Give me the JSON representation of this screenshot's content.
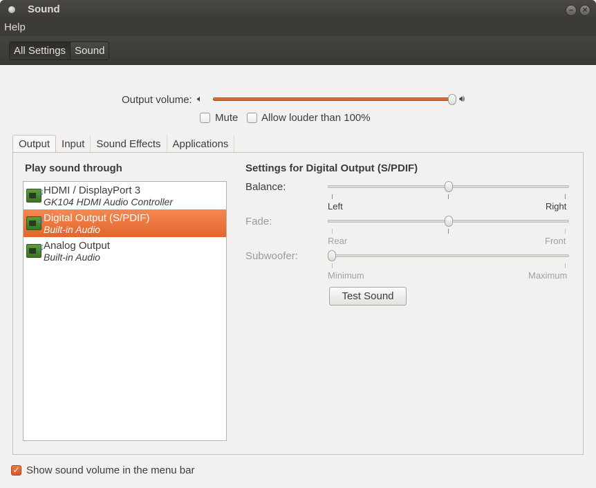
{
  "window": {
    "title": "Sound"
  },
  "menu": {
    "items": [
      "Help"
    ]
  },
  "breadcrumbs": [
    "All Settings",
    "Sound"
  ],
  "volume": {
    "label": "Output volume:",
    "level": 1.0,
    "low_icon": "speaker-low-icon",
    "high_icon": "speaker-high-icon",
    "mute_label": "Mute",
    "mute_checked": false,
    "louder_label": "Allow louder than 100%",
    "louder_checked": false
  },
  "tabs": [
    {
      "label": "Output",
      "active": true
    },
    {
      "label": "Input",
      "active": false
    },
    {
      "label": "Sound Effects",
      "active": false
    },
    {
      "label": "Applications",
      "active": false
    }
  ],
  "output": {
    "list_heading": "Play sound through",
    "devices": [
      {
        "name": "HDMI / DisplayPort 3",
        "sub": "GK104 HDMI Audio Controller",
        "selected": false
      },
      {
        "name": "Digital Output (S/PDIF)",
        "sub": "Built-in Audio",
        "selected": true
      },
      {
        "name": "Analog Output",
        "sub": "Built-in Audio",
        "selected": false
      }
    ],
    "settings_heading": "Settings for Digital Output (S/PDIF)",
    "balance": {
      "label": "Balance:",
      "left": "Left",
      "right": "Right",
      "value": 0.5
    },
    "fade": {
      "label": "Fade:",
      "left": "Rear",
      "right": "Front",
      "value": 0.5
    },
    "subwoofer": {
      "label": "Subwoofer:",
      "left": "Minimum",
      "right": "Maximum",
      "value": 0.0
    },
    "test_button": "Test Sound"
  },
  "footer": {
    "show_volume_label": "Show sound volume in the menu bar",
    "show_volume_checked": true
  },
  "colors": {
    "accent": "#e2662e",
    "titlebar": "#3c3b37"
  }
}
